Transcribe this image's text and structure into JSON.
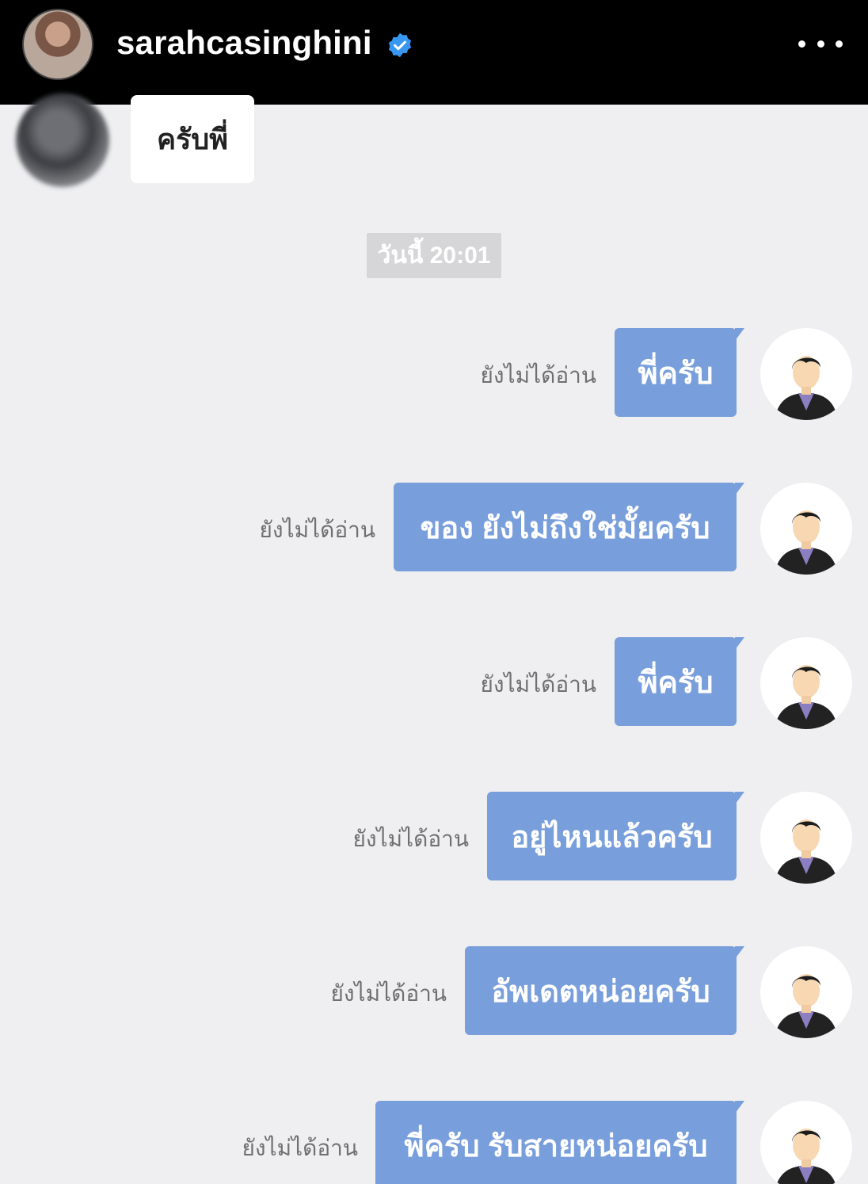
{
  "header": {
    "username": "sarahcasinghini",
    "verified_icon": "verified-badge-icon",
    "more_icon": "more-dots-icon",
    "accent_verified": "#3897f0"
  },
  "chat": {
    "incoming_message": "ครับพี่",
    "timestamp": "วันนี้ 20:01",
    "bubble_color": "#789edb",
    "messages": [
      {
        "text": "พี่ครับ",
        "status": "ยังไม่ได้อ่าน"
      },
      {
        "text": "ของ ยังไม่ถึงใช่มั้ยครับ",
        "status": "ยังไม่ได้อ่าน"
      },
      {
        "text": "พี่ครับ",
        "status": "ยังไม่ได้อ่าน"
      },
      {
        "text": "อยู่ไหนแล้วครับ",
        "status": "ยังไม่ได้อ่าน"
      },
      {
        "text": "อัพเดตหน่อยครับ",
        "status": "ยังไม่ได้อ่าน"
      },
      {
        "text": "พี่ครับ รับสายหน่อยครับ",
        "status": "ยังไม่ได้อ่าน"
      }
    ]
  }
}
